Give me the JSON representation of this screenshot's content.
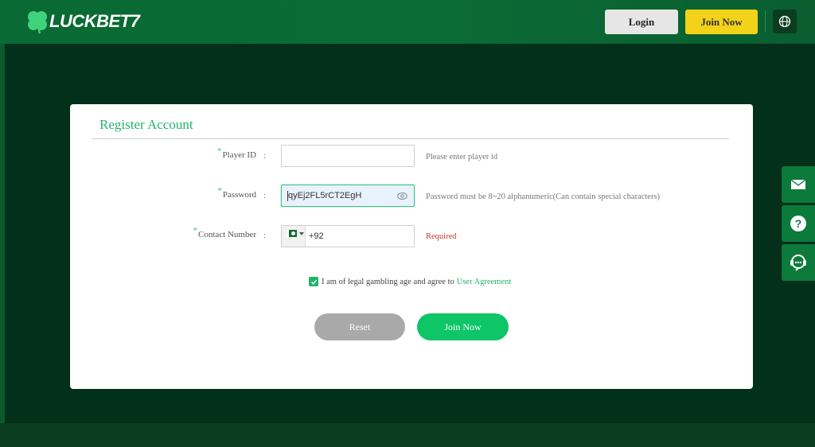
{
  "header": {
    "logo_text": "LUCKBET7",
    "login_label": "Login",
    "join_label": "Join Now",
    "globe_icon": "globe-icon"
  },
  "form": {
    "title": "Register Account",
    "player_id": {
      "label": "Player ID",
      "colon": ":",
      "value": "",
      "hint": "Please enter player id"
    },
    "password": {
      "label": "Password",
      "colon": ":",
      "value": "qyEj2FL5rCT2EgH",
      "hint": "Password must be 8~20 alphanumeric(Can contain special characters)",
      "eye_icon": "eye-icon"
    },
    "contact": {
      "label": "Contact Number",
      "colon": ":",
      "country_flag": "pakistan-flag-icon",
      "value": "+92",
      "hint": "Required"
    },
    "agreement": {
      "checked": true,
      "text": "I am of legal gambling age and agree to",
      "link": "User Agreement"
    },
    "reset_label": "Reset",
    "join_label": "Join Now"
  },
  "side_widgets": [
    "mail-icon",
    "help-icon",
    "support-chat-icon"
  ],
  "colors": {
    "brand_green": "#22b36a",
    "join_button": "#0ec567",
    "header_join": "#f3d21a",
    "required_red": "#c0392b"
  }
}
